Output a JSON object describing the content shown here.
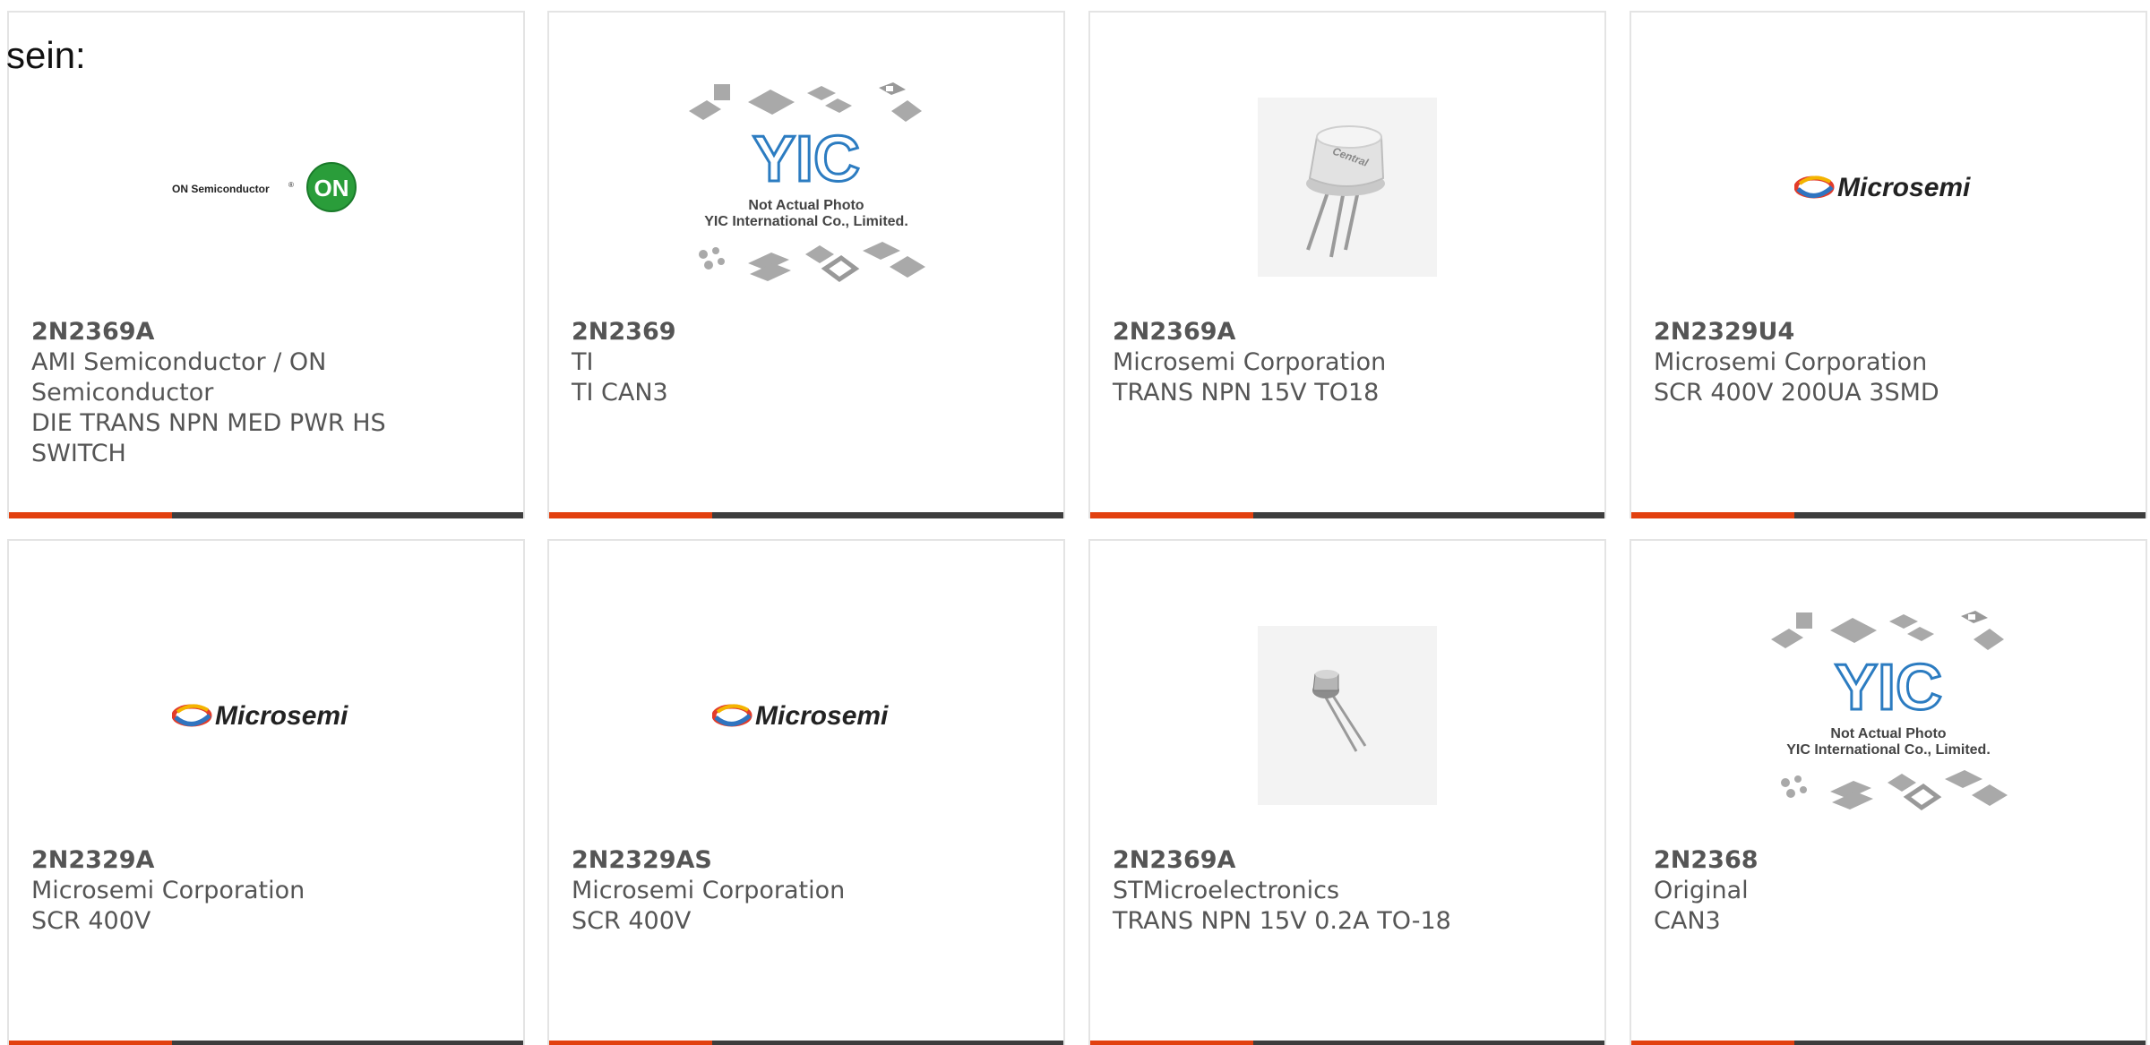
{
  "lead_text": "sein:",
  "images": {
    "on_semi_logo_text": "ON Semiconductor",
    "on_semi_badge": "ON",
    "microsemi_logo_text": "Microsemi",
    "yic_logo_text": "YIC",
    "yic_caption_line1": "Not Actual Photo",
    "yic_caption_line2": "YIC International Co., Limited.",
    "transistor_marking": "Central"
  },
  "colors": {
    "accent": "#e2400f",
    "bar": "#3d3d3d",
    "text": "#555555",
    "border": "#e4e4e4"
  },
  "products": [
    {
      "part": "2N2369A",
      "lines": [
        "AMI Semiconductor / ON",
        "Semiconductor",
        "DIE TRANS NPN MED PWR HS",
        "SWITCH"
      ],
      "image": "on-semiconductor-logo"
    },
    {
      "part": "2N2369",
      "lines": [
        "TI",
        "TI CAN3"
      ],
      "image": "yic-not-actual-photo"
    },
    {
      "part": "2N2369A",
      "lines": [
        "Microsemi Corporation",
        "TRANS NPN 15V TO18"
      ],
      "image": "to18-transistor-photo"
    },
    {
      "part": "2N2329U4",
      "lines": [
        "Microsemi Corporation",
        "SCR 400V 200UA 3SMD"
      ],
      "image": "microsemi-logo"
    },
    {
      "part": "2N2329A",
      "lines": [
        "Microsemi Corporation",
        "SCR 400V"
      ],
      "image": "microsemi-logo"
    },
    {
      "part": "2N2329AS",
      "lines": [
        "Microsemi Corporation",
        "SCR 400V"
      ],
      "image": "microsemi-logo"
    },
    {
      "part": "2N2369A",
      "lines": [
        "STMicroelectronics",
        "TRANS NPN 15V 0.2A TO-18"
      ],
      "image": "small-transistor-photo"
    },
    {
      "part": "2N2368",
      "lines": [
        "Original",
        "CAN3"
      ],
      "image": "yic-not-actual-photo"
    }
  ]
}
